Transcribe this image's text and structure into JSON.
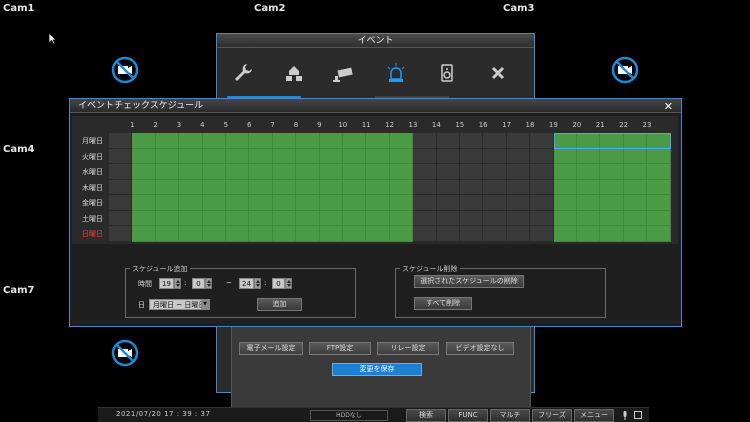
{
  "cameras": [
    "Cam1",
    "Cam2",
    "Cam3",
    "Cam4",
    "Cam7"
  ],
  "event_dialog": {
    "title": "イベント",
    "tabs": [
      "wrench-icon",
      "network-icon",
      "camera-icon",
      "alarm-icon",
      "speaker-icon",
      "close-icon"
    ],
    "buttons": [
      "電子メール設定",
      "FTP設定",
      "リレー設定",
      "ビデオ設定なし"
    ],
    "save_label": "変更を保存"
  },
  "schedule_dialog": {
    "title": "イベントチェックスケジュール",
    "hours": [
      "1",
      "2",
      "3",
      "4",
      "5",
      "6",
      "7",
      "8",
      "9",
      "10",
      "11",
      "12",
      "13",
      "14",
      "15",
      "16",
      "17",
      "18",
      "19",
      "20",
      "21",
      "22",
      "23"
    ],
    "days": [
      {
        "label": "月曜日",
        "sunday": false
      },
      {
        "label": "火曜日",
        "sunday": false
      },
      {
        "label": "水曜日",
        "sunday": false
      },
      {
        "label": "木曜日",
        "sunday": false
      },
      {
        "label": "金曜日",
        "sunday": false
      },
      {
        "label": "土曜日",
        "sunday": false
      },
      {
        "label": "日曜日",
        "sunday": true
      }
    ],
    "active_ranges": [
      [
        1,
        12
      ],
      [
        19,
        23
      ]
    ],
    "add": {
      "legend": "スケジュール追加",
      "time_label": "時間",
      "start_hour": "19",
      "start_min": "0",
      "dash": "~",
      "end_hour": "24",
      "end_min": "0",
      "day_label": "日",
      "day_value": "月曜日 ~ 日曜日",
      "add_button": "追加"
    },
    "delete": {
      "legend": "スケジュール削除",
      "delete_selected": "選択されたスケジュールの削除",
      "delete_all": "すべて削除"
    }
  },
  "statusbar": {
    "datetime": "2021/07/20  17 : 39 : 37",
    "hdd": "HDDなし",
    "buttons": [
      "検索",
      "FUNC",
      "マルチ",
      "フリーズ",
      "メニュー"
    ]
  }
}
